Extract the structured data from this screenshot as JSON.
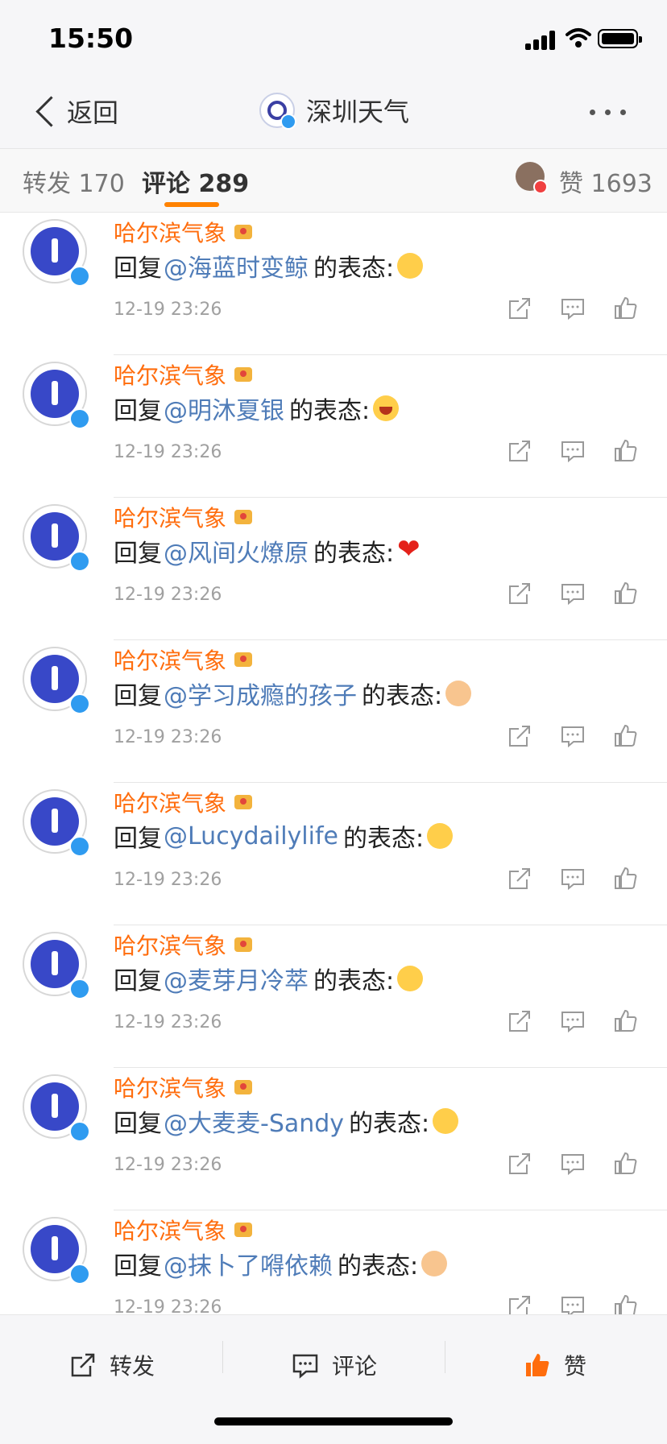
{
  "status": {
    "time": "15:50"
  },
  "nav": {
    "back_label": "返回",
    "title": "深圳天气",
    "more": "···"
  },
  "tabs": {
    "repost": "转发 170",
    "comments": "评论 289",
    "likes": "赞 1693"
  },
  "comments": [
    {
      "name": "哈尔滨气象",
      "prefix": "回复",
      "mention": "@海蓝时变鲸",
      "suffix": "的表态:",
      "emoji": "face",
      "time": "12-19 23:26"
    },
    {
      "name": "哈尔滨气象",
      "prefix": "回复",
      "mention": "@明沐夏银",
      "suffix": "的表态:",
      "emoji": "laugh",
      "time": "12-19 23:26"
    },
    {
      "name": "哈尔滨气象",
      "prefix": "回复",
      "mention": "@风间火燎原",
      "suffix": "的表态:",
      "emoji": "heart",
      "time": "12-19 23:26"
    },
    {
      "name": "哈尔滨气象",
      "prefix": "回复",
      "mention": "@学习成瘾的孩子",
      "suffix": "的表态:",
      "emoji": "fist",
      "time": "12-19 23:26"
    },
    {
      "name": "哈尔滨气象",
      "prefix": "回复",
      "mention": "@Lucydailylife",
      "suffix": "的表态:",
      "emoji": "face",
      "time": "12-19 23:26"
    },
    {
      "name": "哈尔滨气象",
      "prefix": "回复",
      "mention": "@麦芽月冷萃",
      "suffix": "的表态:",
      "emoji": "face",
      "time": "12-19 23:26"
    },
    {
      "name": "哈尔滨气象",
      "prefix": "回复",
      "mention": "@大麦麦-Sandy",
      "suffix": "的表态:",
      "emoji": "face",
      "time": "12-19 23:26"
    },
    {
      "name": "哈尔滨气象",
      "prefix": "回复",
      "mention": "@抹卜了嘚依赖",
      "suffix": "的表态:",
      "emoji": "fist",
      "time": "12-19 23:26"
    }
  ],
  "bottom": {
    "repost": "转发",
    "comment": "评论",
    "like": "赞"
  },
  "colors": {
    "accent": "#ff8200",
    "name": "#ff6d0d",
    "mention": "#4f7cb8",
    "verified": "#2f9bf0"
  },
  "icons": [
    "back-chevron-icon",
    "more-icon",
    "share-icon",
    "comment-icon",
    "like-icon",
    "verified-badge-icon",
    "crown-icon"
  ]
}
